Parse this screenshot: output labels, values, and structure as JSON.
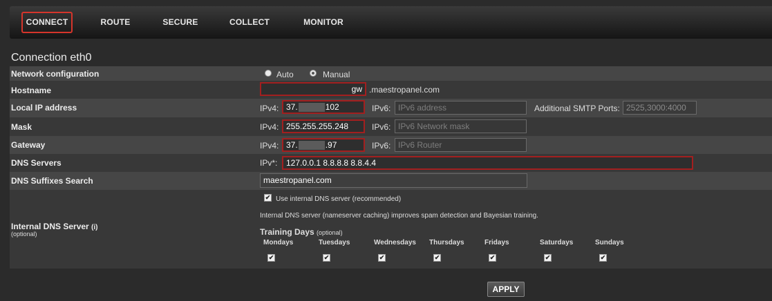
{
  "nav": {
    "items": [
      {
        "label": "CONNECT",
        "active": true
      },
      {
        "label": "ROUTE"
      },
      {
        "label": "SECURE"
      },
      {
        "label": "COLLECT"
      },
      {
        "label": "MONITOR"
      }
    ]
  },
  "section_title": "Connection eth0",
  "network_config": {
    "label": "Network configuration",
    "auto_label": "Auto",
    "manual_label": "Manual",
    "selected": "Manual"
  },
  "hostname": {
    "label": "Hostname",
    "value": "gw",
    "suffix": ".maestropanel.com"
  },
  "local_ip": {
    "label": "Local IP address",
    "ipv4_prefix": "IPv4:",
    "ipv4_start": "37.",
    "ipv4_end": "102",
    "ipv6_prefix": "IPv6:",
    "ipv6_placeholder": "IPv6 address",
    "smtp_label": "Additional SMTP Ports:",
    "smtp_value": "2525,3000:4000"
  },
  "mask": {
    "label": "Mask",
    "ipv4_prefix": "IPv4:",
    "ipv4_value": "255.255.255.248",
    "ipv6_prefix": "IPv6:",
    "ipv6_placeholder": "IPv6 Network mask"
  },
  "gateway": {
    "label": "Gateway",
    "ipv4_prefix": "IPv4:",
    "ipv4_start": "37.",
    "ipv4_end": ".97",
    "ipv6_prefix": "IPv6:",
    "ipv6_placeholder": "IPv6 Router"
  },
  "dns": {
    "label": "DNS Servers",
    "prefix": "IPv*:",
    "value": "127.0.0.1 8.8.8.8 8.8.4.4"
  },
  "dns_suffix": {
    "label": "DNS Suffixes Search",
    "value": "maestropanel.com"
  },
  "internal_dns": {
    "label": "Internal DNS Server",
    "info_mark": "(i)",
    "optional": "(optional)",
    "use_label": "Use internal DNS server (recommended)",
    "use_checked": true,
    "description": "Internal DNS server (nameserver caching) improves spam detection and Bayesian training.",
    "training_title": "Training Days",
    "training_optional": "(optional)",
    "days": [
      {
        "label": "Mondays",
        "checked": true
      },
      {
        "label": "Tuesdays",
        "checked": true
      },
      {
        "label": "Wednesdays",
        "checked": true
      },
      {
        "label": "Thursdays",
        "checked": true
      },
      {
        "label": "Fridays",
        "checked": true
      },
      {
        "label": "Saturdays",
        "checked": true
      },
      {
        "label": "Sundays",
        "checked": true
      }
    ]
  },
  "apply_label": "APPLY",
  "colors": {
    "background": "#2b2b2b",
    "required_border": "#a31f1f",
    "active_nav_border": "#d6352b"
  }
}
